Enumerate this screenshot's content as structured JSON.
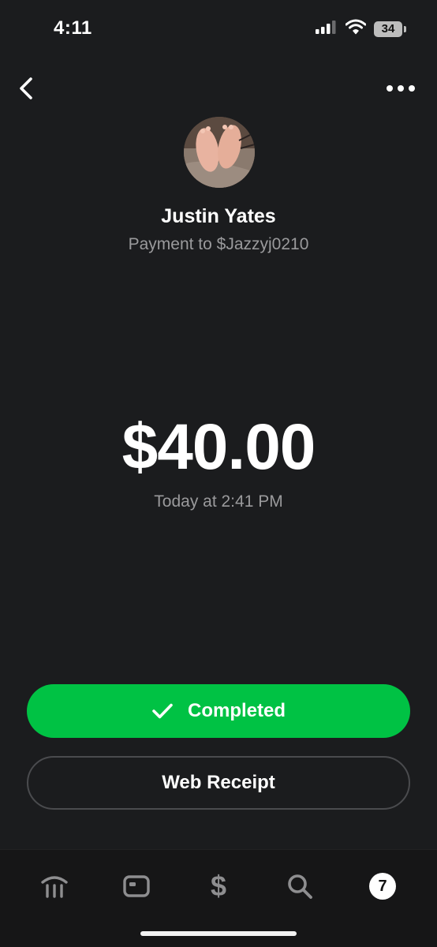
{
  "status_bar": {
    "time": "4:11",
    "battery": "34",
    "icons": [
      "cellular-signal-icon",
      "wifi-icon",
      "battery-icon"
    ]
  },
  "header": {
    "back_icon": "chevron-left-icon",
    "more_icon": "more-dots-icon"
  },
  "recipient": {
    "name": "Justin Yates",
    "subtitle": "Payment to $Jazzyj0210"
  },
  "payment": {
    "amount": "$40.00",
    "timestamp": "Today at 2:41 PM"
  },
  "buttons": {
    "completed_label": "Completed",
    "completed_icon": "checkmark-icon",
    "receipt_label": "Web Receipt"
  },
  "tab_bar": {
    "tabs": [
      {
        "name": "banking",
        "icon": "bank-icon"
      },
      {
        "name": "card",
        "icon": "card-icon"
      },
      {
        "name": "pay",
        "icon": "dollar-icon",
        "glyph": "$"
      },
      {
        "name": "search",
        "icon": "search-icon"
      },
      {
        "name": "activity",
        "icon": "activity-badge-icon",
        "badge": "7"
      }
    ]
  },
  "colors": {
    "background": "#1b1c1e",
    "accent_green": "#00c244",
    "muted_text": "#9a9a9c",
    "tab_icon": "#8e8e90"
  }
}
